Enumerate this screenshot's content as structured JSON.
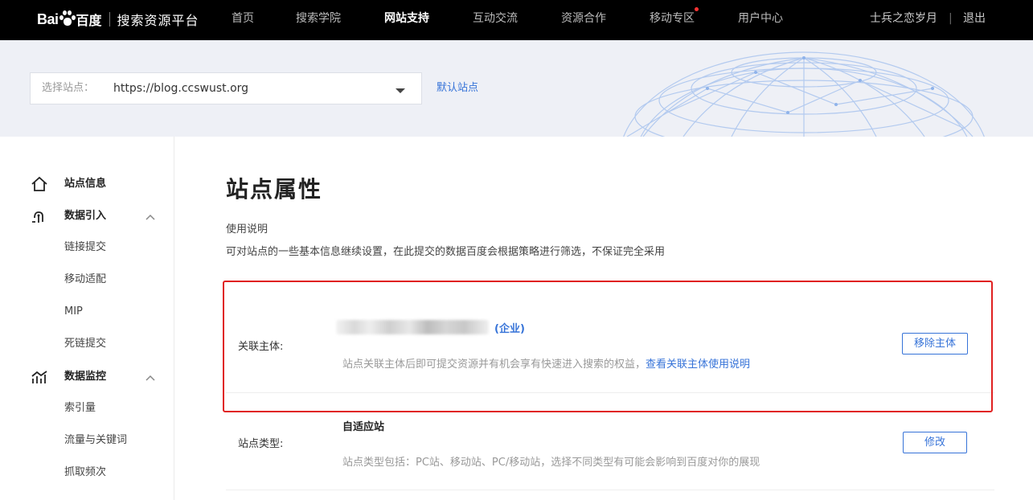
{
  "header": {
    "logo_bai": "Bai",
    "logo_du": "百度",
    "logo_title": "搜索资源平台",
    "nav": [
      "首页",
      "搜索学院",
      "网站支持",
      "互动交流",
      "资源合作",
      "移动专区",
      "用户中心"
    ],
    "active_nav": "网站支持",
    "username": "士兵之恋岁月",
    "separator": "|",
    "logout": "退出"
  },
  "banner": {
    "select_label": "选择站点：",
    "select_value": "https://blog.ccswust.org",
    "default_site": "默认站点"
  },
  "sidebar": {
    "site_info": "站点信息",
    "data_import": {
      "label": "数据引入",
      "items": [
        "链接提交",
        "移动适配",
        "MIP",
        "死链提交"
      ]
    },
    "data_monitor": {
      "label": "数据监控",
      "items": [
        "索引量",
        "流量与关键词",
        "抓取频次"
      ]
    }
  },
  "main": {
    "title": "站点属性",
    "help_head": "使用说明",
    "help_text": "可对站点的一些基本信息继续设置，在此提交的数据百度会根据策略进行筛选，不保证完全采用",
    "entity": {
      "label": "关联主体:",
      "type_tag": "(企业)",
      "desc": "站点关联主体后即可提交资源并有机会享有快速进入搜索的权益，",
      "link": "查看关联主体使用说明",
      "button": "移除主体"
    },
    "site_type": {
      "label": "站点类型:",
      "value": "自适应站",
      "desc": "站点类型包括：PC站、移动站、PC/移动站，选择不同类型有可能会影响到百度对你的展现",
      "button": "修改"
    }
  },
  "colors": {
    "accent": "#3673d8",
    "highlight_border": "#e02020",
    "topbar": "#000000",
    "banner_bg": "#eef0f6"
  }
}
